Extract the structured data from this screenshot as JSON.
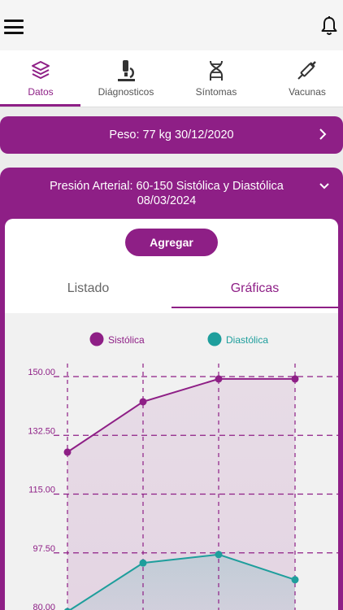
{
  "tabs": [
    {
      "label": "Datos",
      "icon": "layers-icon",
      "active": true
    },
    {
      "label": "Diágnosticos",
      "icon": "microscope-icon",
      "active": false
    },
    {
      "label": "Síntomas",
      "icon": "dna-icon",
      "active": false
    },
    {
      "label": "Vacunas",
      "icon": "syringe-icon",
      "active": false
    }
  ],
  "peso": {
    "text": "Peso: 77 kg 30/12/2020"
  },
  "presion": {
    "title_line1": "Presión Arterial: 60-150 Sistólica y Diastólica",
    "title_line2": "08/03/2024",
    "add_label": "Agregar",
    "subtabs": {
      "listado": "Listado",
      "graficas": "Gráficas"
    }
  },
  "colors": {
    "accent": "#8e1f86",
    "teal": "#1e9e9c"
  },
  "chart_data": {
    "type": "line",
    "x": [
      1,
      2,
      3,
      4
    ],
    "series": [
      {
        "name": "Sistólica",
        "color": "#8e1f86",
        "values": [
          127.5,
          142.5,
          149.3,
          149.3
        ]
      },
      {
        "name": "Diastólica",
        "color": "#1e9e9c",
        "values": [
          80.0,
          94.5,
          97.0,
          89.5
        ]
      }
    ],
    "y_ticks": [
      "150.00",
      "132.50",
      "115.00",
      "97.50",
      "80.00"
    ],
    "y_tick_values": [
      150,
      132.5,
      115,
      97.5,
      80
    ],
    "ylim": [
      80,
      150
    ],
    "grid": true,
    "legend": "top"
  }
}
